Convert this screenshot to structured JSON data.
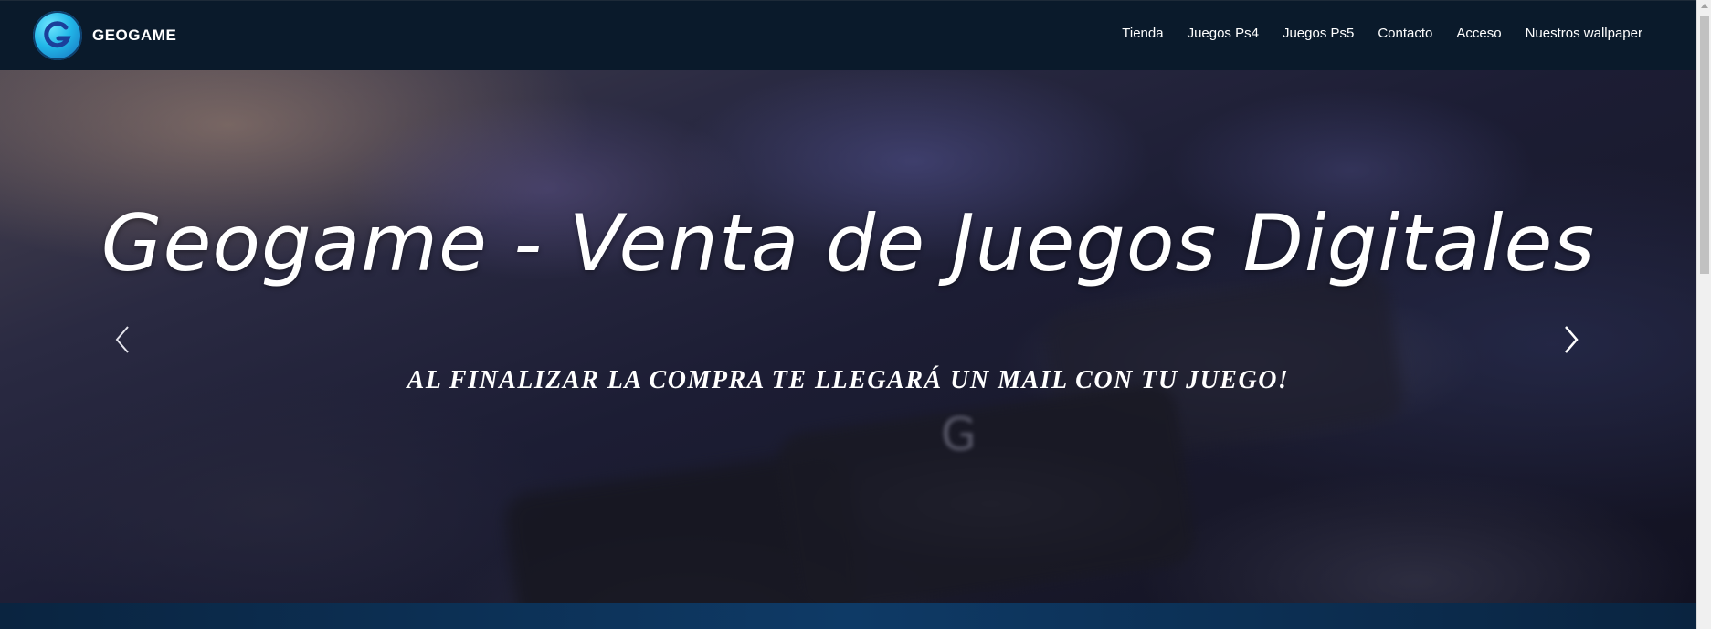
{
  "header": {
    "brand": "GEOGAME",
    "logo_letter": "G",
    "nav": [
      {
        "label": "Tienda"
      },
      {
        "label": "Juegos Ps4"
      },
      {
        "label": "Juegos Ps5"
      },
      {
        "label": "Contacto"
      },
      {
        "label": "Acceso"
      },
      {
        "label": "Nuestros wallpaper"
      }
    ]
  },
  "hero": {
    "title": "Geogame - Venta de Juegos Digitales",
    "subtitle": "AL FINALIZAR LA COMPRA TE LLEGARÁ UN MAIL CON TU JUEGO!",
    "prev_icon": "chevron-left-icon",
    "next_icon": "chevron-right-icon"
  },
  "colors": {
    "header_bg": "#0a1a2b",
    "logo_accent": "#21b6e8",
    "text": "#ffffff",
    "bottom_bar": "#0e3a66"
  }
}
